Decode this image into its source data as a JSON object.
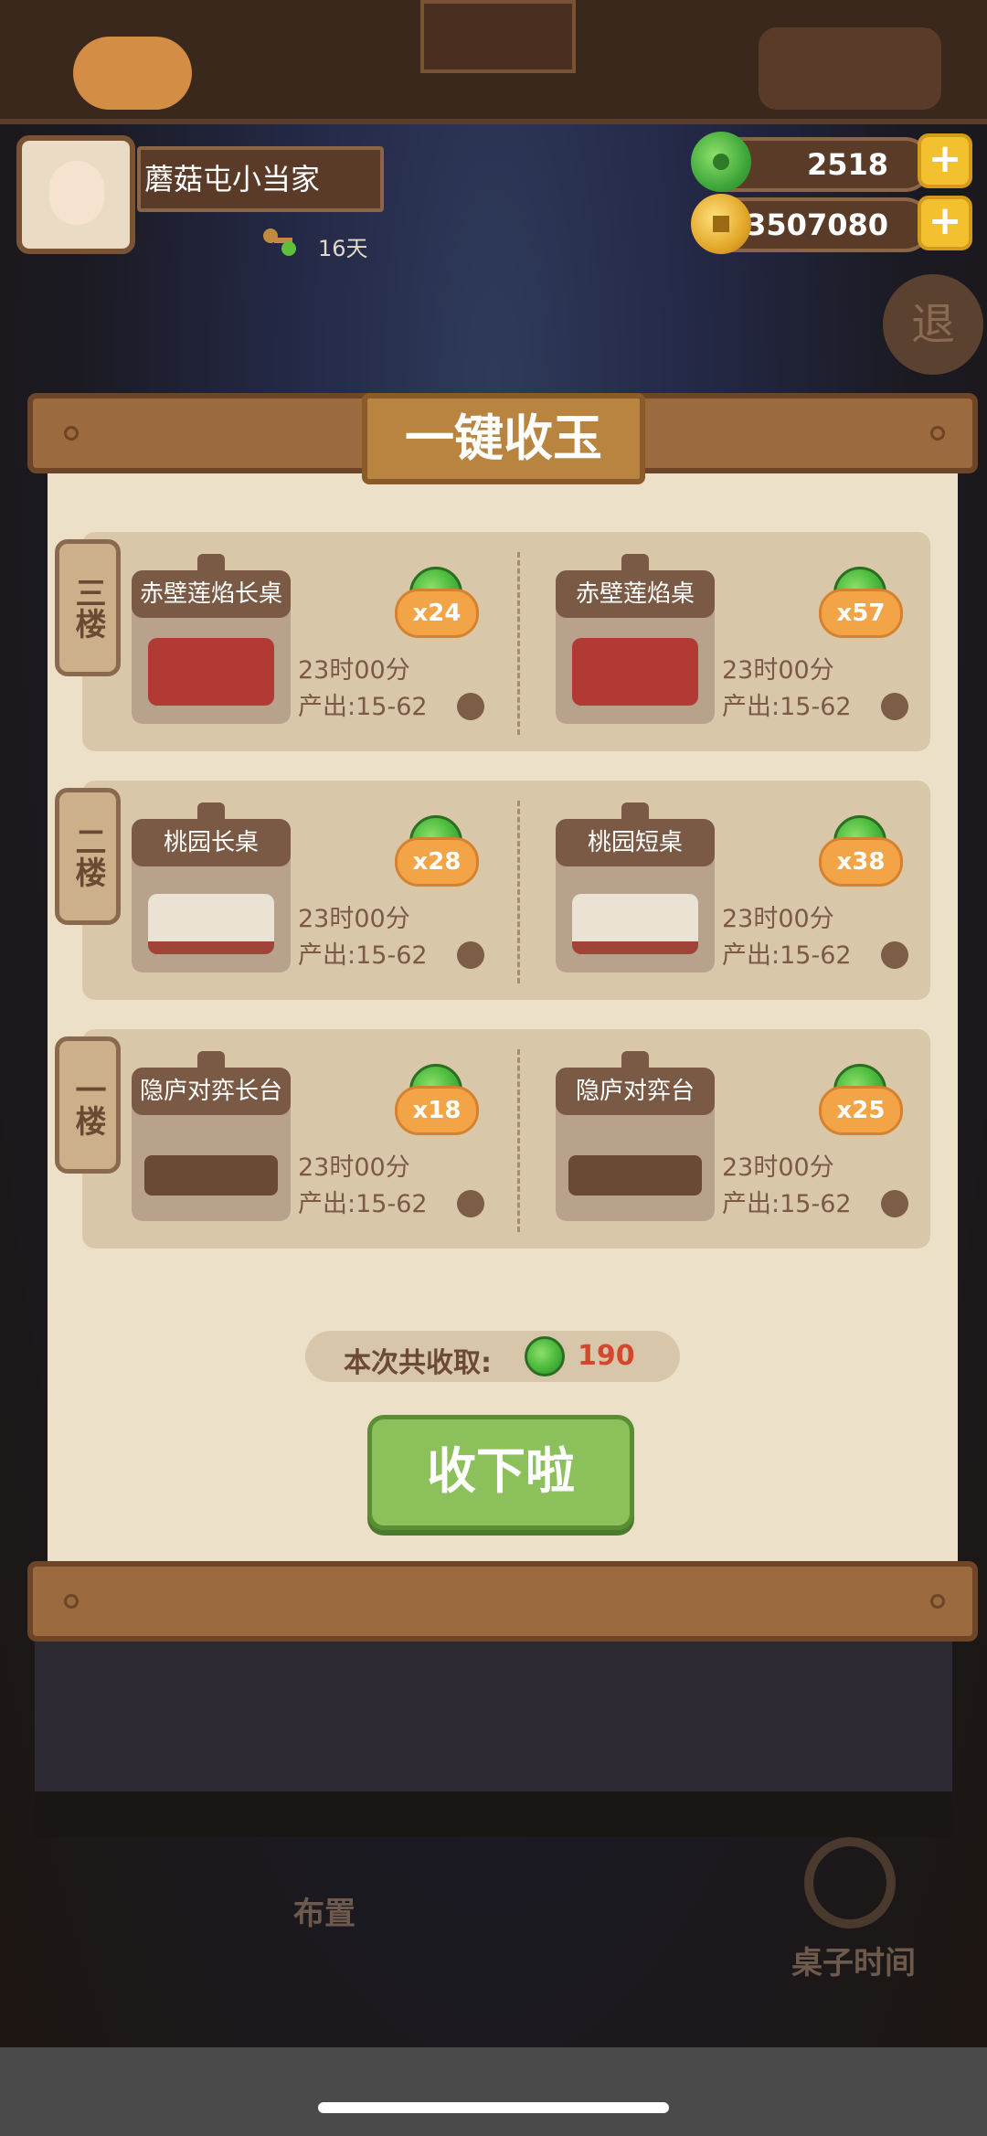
{
  "header": {
    "player_name": "蘑菇屯小当家",
    "days": "16天",
    "jade_balance": "2518",
    "coin_balance": "43507080",
    "exit_label": "退",
    "plus_symbol": "+"
  },
  "modal": {
    "title": "一键收玉",
    "floors": [
      {
        "floor_label": "三楼",
        "tables": [
          {
            "name": "赤壁莲焰长桌",
            "count": "x24",
            "time": "23时00分",
            "output": "产出:15-62"
          },
          {
            "name": "赤壁莲焰桌",
            "count": "x57",
            "time": "23时00分",
            "output": "产出:15-62"
          }
        ]
      },
      {
        "floor_label": "二楼",
        "tables": [
          {
            "name": "桃园长桌",
            "count": "x28",
            "time": "23时00分",
            "output": "产出:15-62"
          },
          {
            "name": "桃园短桌",
            "count": "x38",
            "time": "23时00分",
            "output": "产出:15-62"
          }
        ]
      },
      {
        "floor_label": "一楼",
        "tables": [
          {
            "name": "隐庐对弈长台",
            "count": "x18",
            "time": "23时00分",
            "output": "产出:15-62"
          },
          {
            "name": "隐庐对弈台",
            "count": "x25",
            "time": "23时00分",
            "output": "产出:15-62"
          }
        ]
      }
    ],
    "summary_label": "本次共收取:",
    "summary_value": "190",
    "collect_button": "收下啦"
  },
  "background": {
    "layout_button": "布置",
    "table_time_button": "桌子时间"
  },
  "colors": {
    "wood": "#9b6a3e",
    "paper": "#ede0c8",
    "jade_green": "#4dbb3e",
    "badge_orange": "#f3a446",
    "collect_green": "#8cc05a",
    "summary_red": "#d4472c"
  },
  "icons": [
    "jade-icon",
    "coin-icon",
    "plus-icon",
    "key-icon",
    "clock-icon"
  ]
}
